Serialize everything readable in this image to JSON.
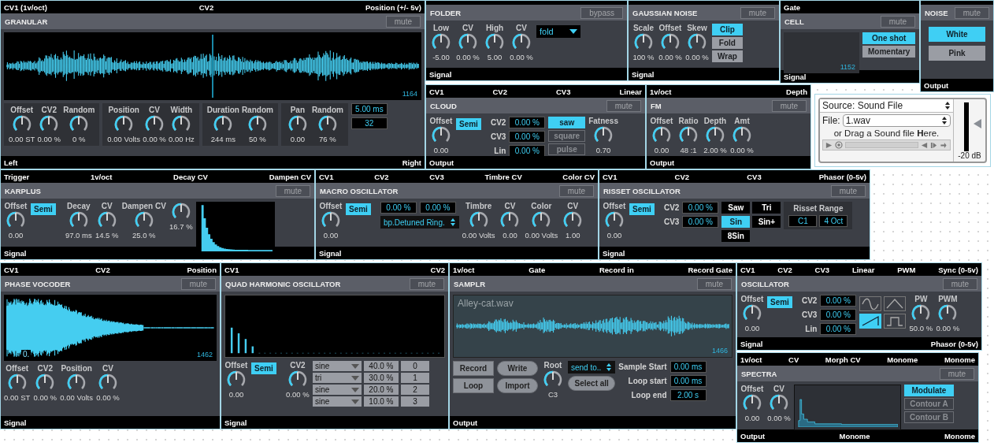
{
  "modules": [
    {
      "title": "GRANULAR",
      "inlets": [
        "CV1 (1v/oct)",
        "CV2",
        "Position (+/- 5v)"
      ],
      "switch": "mute",
      "body": [
        {
          "kind": "scope",
          "readout": "1164"
        },
        {
          "kind": "row",
          "items": [
            {
              "kind": "panel",
              "items": [
                {
                  "kind": "knob",
                  "label": "Offset",
                  "value": "0.00 ST"
                },
                {
                  "kind": "knob",
                  "label": "CV2",
                  "value": "0.00 %"
                },
                {
                  "kind": "knob",
                  "label": "Random",
                  "value": "0 %"
                }
              ]
            },
            {
              "kind": "panel",
              "items": [
                {
                  "kind": "knob",
                  "label": "Position",
                  "value": "0.00 Volts"
                },
                {
                  "kind": "knob",
                  "label": "CV",
                  "value": "0.00 %"
                },
                {
                  "kind": "knob",
                  "label": "Width",
                  "value": "0.00 Hz"
                }
              ]
            },
            {
              "kind": "panel",
              "items": [
                {
                  "kind": "knob",
                  "label": "Duration",
                  "value": "244 ms"
                },
                {
                  "kind": "knob",
                  "label": "Random",
                  "value": "50 %"
                }
              ]
            },
            {
              "kind": "panel",
              "items": [
                {
                  "kind": "knob",
                  "label": "Pan",
                  "value": "0.00"
                },
                {
                  "kind": "knob",
                  "label": "Random",
                  "value": "76 %"
                }
              ]
            },
            {
              "kind": "column",
              "items": [
                {
                  "kind": "field",
                  "value": "5.00 ms"
                },
                {
                  "kind": "field",
                  "value": "32"
                }
              ]
            }
          ]
        }
      ],
      "outlets": [
        "Left",
        "Right"
      ]
    },
    {
      "title": "FOLDER",
      "switch": "bypass",
      "body": [
        {
          "kind": "knob",
          "label": "Low",
          "value": "-5.00"
        },
        {
          "kind": "knob",
          "label": "CV",
          "value": "0.00 %"
        },
        {
          "kind": "knob",
          "label": "High",
          "value": "5.00"
        },
        {
          "kind": "knob",
          "label": "CV",
          "value": "0.00 %"
        },
        {
          "kind": "dropdown",
          "value": "fold"
        }
      ],
      "outlets": [
        "Signal"
      ]
    },
    {
      "title": "GAUSSIAN NOISE",
      "switch": "mute",
      "body": [
        {
          "kind": "knob",
          "label": "Scale",
          "value": "100 %"
        },
        {
          "kind": "knob",
          "label": "Offset",
          "value": "0.00 %"
        },
        {
          "kind": "knob",
          "label": "Skew",
          "value": "0.00 %"
        },
        {
          "kind": "buttons",
          "items": [
            {
              "label": "Clip",
              "selected": true
            },
            {
              "label": "Fold",
              "selected": false
            },
            {
              "label": "Wrap",
              "selected": false
            }
          ]
        }
      ],
      "outlets": [
        "Signal"
      ]
    },
    {
      "title": "CELL",
      "inlets": [
        "Gate"
      ],
      "switch": "mute",
      "body": [
        {
          "kind": "scope",
          "readout": "1152"
        },
        {
          "kind": "buttons",
          "items": [
            {
              "label": "One shot",
              "selected": true
            },
            {
              "label": "Momentary",
              "selected": false
            }
          ]
        }
      ],
      "outlets": [
        "Signal"
      ]
    },
    {
      "title": "NOISE",
      "switch": "mute",
      "body": [
        {
          "kind": "buttons",
          "items": [
            {
              "label": "White",
              "selected": true
            },
            {
              "label": "Pink",
              "selected": false
            }
          ]
        }
      ],
      "outlets": [
        "Output"
      ]
    },
    {
      "title": "CLOUD",
      "inlets": [
        "CV1",
        "CV2",
        "CV3",
        "Linear"
      ],
      "switch": "mute",
      "body": [
        {
          "kind": "knob",
          "label": "Offset",
          "value": "0.00"
        },
        {
          "kind": "toggle",
          "label": "Semi",
          "selected": true
        },
        {
          "kind": "column",
          "items": [
            {
              "kind": "field",
              "label": "CV2",
              "value": "0.00 %"
            },
            {
              "kind": "field",
              "label": "CV3",
              "value": "0.00 %"
            },
            {
              "kind": "field",
              "label": "Lin",
              "value": "0.00 %"
            }
          ]
        },
        {
          "kind": "buttons",
          "items": [
            {
              "label": "saw",
              "selected": true
            },
            {
              "label": "square",
              "selected": false
            },
            {
              "label": "pulse",
              "selected": false
            }
          ]
        },
        {
          "kind": "knob",
          "label": "Fatness",
          "value": "0.70"
        }
      ],
      "outlets": [
        "Output"
      ]
    },
    {
      "title": "FM",
      "inlets": [
        "1v/oct",
        "Depth"
      ],
      "switch": "mute",
      "body": [
        {
          "kind": "knob",
          "label": "Offset",
          "value": "0.00"
        },
        {
          "kind": "knob",
          "label": "Ratio",
          "value": "48 :1"
        },
        {
          "kind": "knob",
          "label": "Depth",
          "value": "2.00 %"
        },
        {
          "kind": "knob",
          "label": "Amt",
          "value": "0.00 %"
        }
      ],
      "outlets": [
        "Output"
      ]
    },
    {
      "title": "KARPLUS",
      "inlets": [
        "Trigger",
        "1v/oct",
        "Decay CV",
        "Dampen CV"
      ],
      "switch": "mute",
      "body": [
        {
          "kind": "knob",
          "label": "Offset",
          "value": "0.00"
        },
        {
          "kind": "toggle",
          "label": "Semi",
          "selected": true
        },
        {
          "kind": "knob",
          "label": "Decay",
          "value": "97.0 ms"
        },
        {
          "kind": "knob",
          "label": "CV",
          "value": "14.5 %"
        },
        {
          "kind": "knob",
          "label": "Dampen CV",
          "value": "25.0 %"
        },
        {
          "kind": "knob",
          "value": "16.7 %"
        },
        {
          "kind": "scope"
        }
      ],
      "outlets": [
        "Signal"
      ]
    },
    {
      "title": "MACRO OSCILLATOR",
      "inlets": [
        "CV1",
        "CV2",
        "CV3",
        "Timbre CV",
        "Color CV"
      ],
      "switch": "mute",
      "body": [
        {
          "kind": "knob",
          "label": "Offset",
          "value": "0.00"
        },
        {
          "kind": "toggle",
          "label": "Semi",
          "selected": true
        },
        {
          "kind": "column",
          "items": [
            {
              "kind": "row",
              "items": [
                {
                  "kind": "field",
                  "value": "0.00 %"
                },
                {
                  "kind": "field",
                  "value": "0.00 %"
                }
              ]
            },
            {
              "kind": "dropdown",
              "value": "bp.Detuned Ring."
            }
          ]
        },
        {
          "kind": "knob",
          "label": "Timbre",
          "value": "0.00 Volts"
        },
        {
          "kind": "knob",
          "label": "CV",
          "value": "0.00"
        },
        {
          "kind": "knob",
          "label": "Color",
          "value": "0.00 Volts"
        },
        {
          "kind": "knob",
          "label": "CV",
          "value": "1.00"
        }
      ],
      "outlets": [
        "Signal"
      ]
    },
    {
      "title": "RISSET OSCILLATOR",
      "inlets": [
        "CV1",
        "CV2",
        "CV3",
        "Phasor (0-5v)"
      ],
      "switch": "mute",
      "body": [
        {
          "kind": "knob",
          "label": "Offset",
          "value": "0.00"
        },
        {
          "kind": "toggle",
          "label": "Semi",
          "selected": true
        },
        {
          "kind": "column",
          "items": [
            {
              "kind": "field",
              "label": "CV2",
              "value": "0.00 %"
            },
            {
              "kind": "field",
              "label": "CV3",
              "value": "0.00 %"
            }
          ]
        },
        {
          "kind": "buttons",
          "items": [
            {
              "label": "Saw",
              "selected": false
            },
            {
              "label": "Tri",
              "selected": false
            },
            {
              "label": "Sin",
              "selected": true
            },
            {
              "label": "Sin+",
              "selected": false
            },
            {
              "label": "8Sin",
              "selected": false
            }
          ]
        },
        {
          "kind": "panel",
          "title": "Risset Range",
          "items": [
            {
              "kind": "field",
              "value": "C1"
            },
            {
              "kind": "field",
              "value": "4 Oct"
            }
          ]
        }
      ],
      "outlets": [
        "Signal"
      ]
    },
    {
      "title": "PHASE VOCODER",
      "inlets": [
        "CV1",
        "CV2",
        "Position"
      ],
      "switch": "mute",
      "body": [
        {
          "kind": "scope",
          "marker": "0.",
          "readout": "1462"
        },
        {
          "kind": "knob",
          "label": "Offset",
          "value": "0.00 ST"
        },
        {
          "kind": "knob",
          "label": "CV2",
          "value": "0.00 %"
        },
        {
          "kind": "knob",
          "label": "Position",
          "value": "0.00 Volts"
        },
        {
          "kind": "knob",
          "label": "CV",
          "value": "0.00 %"
        }
      ],
      "outlets": [
        "Signal"
      ]
    },
    {
      "title": "QUAD HARMONIC OSCILLATOR",
      "inlets": [
        "CV1",
        "CV2"
      ],
      "switch": "mute",
      "body": [
        {
          "kind": "scope"
        },
        {
          "kind": "knob",
          "label": "Offset",
          "value": "0.00"
        },
        {
          "kind": "toggle",
          "label": "Semi",
          "selected": true
        },
        {
          "kind": "knob",
          "label": "CV2",
          "value": "0.00 %"
        },
        {
          "kind": "table",
          "rows": [
            {
              "wave": "sine",
              "amount": "40.0 %",
              "index": "0"
            },
            {
              "wave": "tri",
              "amount": "30.0 %",
              "index": "1"
            },
            {
              "wave": "sine",
              "amount": "20.0 %",
              "index": "2"
            },
            {
              "wave": "sine",
              "amount": "10.0 %",
              "index": "3"
            }
          ]
        }
      ],
      "outlets": [
        "Signal"
      ]
    },
    {
      "title": "SAMPLR",
      "inlets": [
        "1v/oct",
        "Gate",
        "Record in",
        "Record Gate"
      ],
      "switch": "mute",
      "body": [
        {
          "kind": "scope",
          "caption": "Alley-cat.wav",
          "readout": "1466"
        },
        {
          "kind": "column",
          "items": [
            {
              "kind": "button",
              "label": "Record"
            },
            {
              "kind": "button",
              "label": "Loop"
            }
          ]
        },
        {
          "kind": "column",
          "items": [
            {
              "kind": "pill",
              "label": "Write"
            },
            {
              "kind": "pill",
              "label": "Import"
            }
          ]
        },
        {
          "kind": "knob",
          "label": "Root",
          "value": "C3"
        },
        {
          "kind": "column",
          "items": [
            {
              "kind": "dropdown",
              "value": "send to.."
            },
            {
              "kind": "pill",
              "label": "Select all"
            }
          ]
        },
        {
          "kind": "column",
          "items": [
            {
              "kind": "field",
              "label": "Sample Start",
              "value": "0.00 ms"
            },
            {
              "kind": "field",
              "label": "Loop start",
              "value": "0.00 ms"
            },
            {
              "kind": "field",
              "label": "Loop end",
              "value": "2.00 s"
            }
          ]
        }
      ],
      "outlets": [
        "Output"
      ]
    },
    {
      "title": "OSCILLATOR",
      "inlets": [
        "CV1",
        "CV2",
        "CV3",
        "Linear",
        "PWM",
        "Sync (0-5v)"
      ],
      "switch": "mute",
      "body": [
        {
          "kind": "knob",
          "label": "Offset",
          "value": "0.00"
        },
        {
          "kind": "toggle",
          "label": "Semi",
          "selected": true
        },
        {
          "kind": "column",
          "items": [
            {
              "kind": "field",
              "label": "CV2",
              "value": "0.00 %"
            },
            {
              "kind": "field",
              "label": "CV3",
              "value": "0.00 %"
            },
            {
              "kind": "field",
              "label": "Lin",
              "value": "0.00 %"
            }
          ]
        },
        {
          "kind": "shapes",
          "items": [
            {
              "selected": false
            },
            {
              "selected": false
            },
            {
              "selected": true
            },
            {
              "selected": false
            }
          ]
        },
        {
          "kind": "knob",
          "label": "PW",
          "value": "50.0 %"
        },
        {
          "kind": "knob",
          "label": "PWM",
          "value": "0.00 %"
        }
      ],
      "outlets": [
        "Signal",
        "Phasor (0-5v)"
      ]
    },
    {
      "title": "SPECTRA",
      "inlets": [
        "1v/oct",
        "CV",
        "Morph CV",
        "Monome",
        "Monome"
      ],
      "switch": "mute",
      "body": [
        {
          "kind": "knob",
          "label": "Offset",
          "value": "0.00"
        },
        {
          "kind": "knob",
          "label": "CV",
          "value": "0.00 %"
        },
        {
          "kind": "scope"
        },
        {
          "kind": "buttons",
          "items": [
            {
              "label": "Modulate",
              "selected": true
            },
            {
              "label": "Contour A",
              "selected": false
            },
            {
              "label": "Contour B",
              "selected": false
            }
          ]
        }
      ],
      "outlets": [
        "Output",
        "Monome",
        "Monome"
      ]
    }
  ],
  "sound_file": {
    "source": "Source: Sound File",
    "file_label": "File:",
    "file": "1.wav",
    "hint": "or Drag a Sound file **H**ere.",
    "level": 0.56,
    "reading": "-20 dB"
  }
}
